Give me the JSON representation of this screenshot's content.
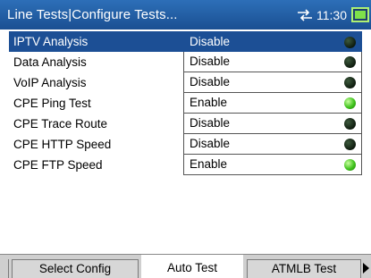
{
  "header": {
    "title": "Line Tests|Configure Tests...",
    "time": "11:30",
    "icons": [
      "network-link-icon",
      "battery-icon"
    ]
  },
  "tests": [
    {
      "name": "IPTV Analysis",
      "value": "Disable",
      "status": "off",
      "selected": true
    },
    {
      "name": "Data Analysis",
      "value": "Disable",
      "status": "off",
      "selected": false
    },
    {
      "name": "VoIP Analysis",
      "value": "Disable",
      "status": "off",
      "selected": false
    },
    {
      "name": "CPE Ping Test",
      "value": "Enable",
      "status": "on",
      "selected": false
    },
    {
      "name": "CPE Trace Route",
      "value": "Disable",
      "status": "off",
      "selected": false
    },
    {
      "name": "CPE HTTP Speed",
      "value": "Disable",
      "status": "off",
      "selected": false
    },
    {
      "name": "CPE FTP Speed",
      "value": "Enable",
      "status": "on",
      "selected": false
    }
  ],
  "tabs": [
    {
      "label": "Select Config",
      "active": false
    },
    {
      "label": "Auto Test",
      "active": true
    },
    {
      "label": "ATMLB Test",
      "active": false
    }
  ],
  "colors": {
    "selection": "#1c4f95",
    "led_on": "#3fc21c",
    "led_off": "#0d1a0d"
  }
}
